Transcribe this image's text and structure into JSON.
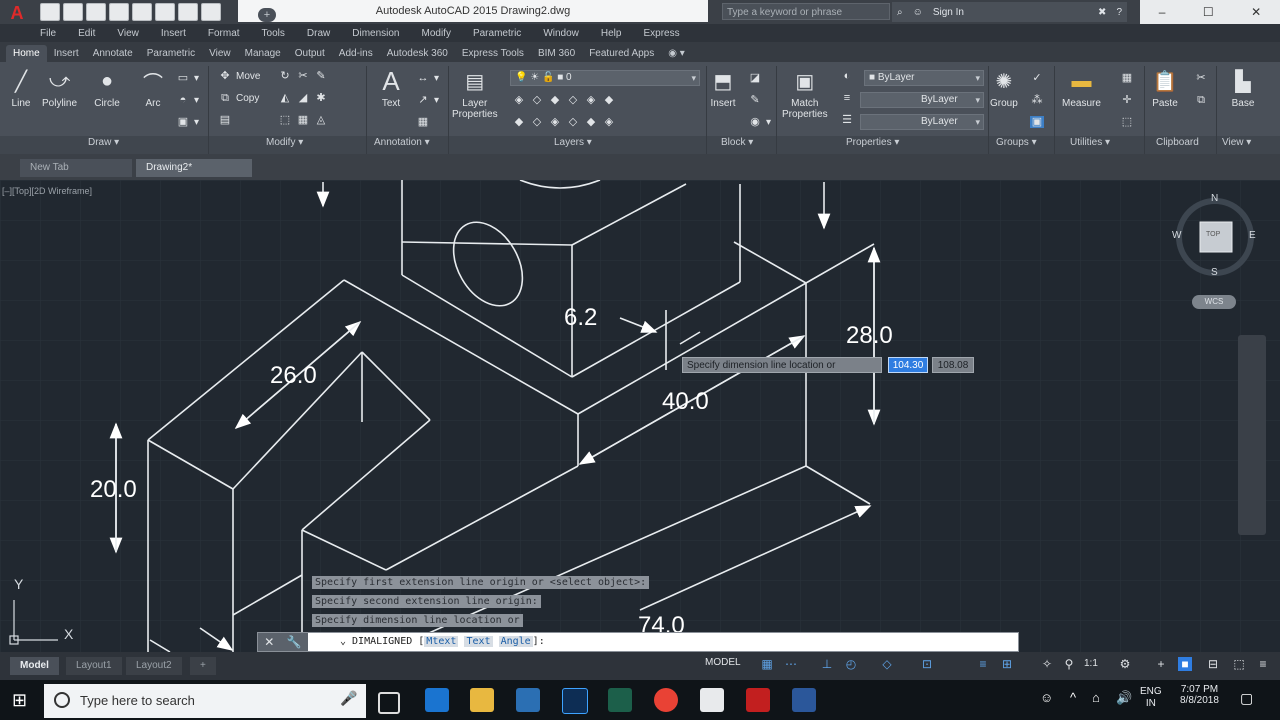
{
  "window": {
    "title": "Autodesk AutoCAD 2015    Drawing2.dwg",
    "search_placeholder": "Type a keyword or phrase",
    "sign_in": "Sign In",
    "min": "–",
    "max": "☐",
    "close": "✕"
  },
  "menu": [
    "File",
    "Edit",
    "View",
    "Insert",
    "Format",
    "Tools",
    "Draw",
    "Dimension",
    "Modify",
    "Parametric",
    "Window",
    "Help",
    "Express"
  ],
  "ribbon_tabs": [
    "Home",
    "Insert",
    "Annotate",
    "Parametric",
    "View",
    "Manage",
    "Output",
    "Add-ins",
    "Autodesk 360",
    "Express Tools",
    "BIM 360",
    "Featured Apps"
  ],
  "ribbon": {
    "draw": {
      "line": "Line",
      "polyline": "Polyline",
      "circle": "Circle",
      "arc": "Arc",
      "panel": "Draw ▾"
    },
    "modify": {
      "move": "Move",
      "copy": "Copy",
      "panel": "Modify ▾"
    },
    "annotation": {
      "text": "Text",
      "panel": "Annotation ▾"
    },
    "layers": {
      "layer_props_1": "Layer",
      "layer_props_2": "Properties",
      "current_layer": "0",
      "panel": "Layers ▾"
    },
    "block": {
      "insert": "Insert",
      "panel": "Block ▾"
    },
    "properties": {
      "match_1": "Match",
      "match_2": "Properties",
      "bylayer1": "ByLayer",
      "bylayer2": "ByLayer",
      "bylayer3": "ByLayer",
      "panel": "Properties ▾"
    },
    "groups": {
      "group": "Group",
      "panel": "Groups ▾"
    },
    "utilities": {
      "measure": "Measure",
      "panel": "Utilities ▾"
    },
    "clipboard": {
      "paste": "Paste",
      "panel": "Clipboard"
    },
    "view": {
      "base": "Base",
      "panel": "View ▾"
    }
  },
  "doc_tabs": {
    "new_tab": "New Tab",
    "drawing": "Drawing2*",
    "plus": "+"
  },
  "viewport_controls": "[–][Top][2D Wireframe]",
  "viewcube": {
    "n": "N",
    "s": "S",
    "e": "E",
    "w": "W",
    "face": "TOP",
    "wcs": "WCS"
  },
  "dimensions": {
    "d1": "6.2",
    "d2": "28.0",
    "d3": "26.0",
    "d4": "40.0",
    "d5": "20.0",
    "d6": "74.0"
  },
  "dynamic_input": {
    "prompt": "Specify dimension line location or",
    "value1": "104.30",
    "value2": "108.08"
  },
  "ucs": {
    "x": "X",
    "y": "Y"
  },
  "command_history": [
    "Specify first extension line origin or <select object>:",
    "Specify second extension line origin:",
    "Specify dimension line location or"
  ],
  "command_line": {
    "prefix": "⌄ DIMALIGNED [",
    "opt1": "Mtext",
    "opt2": "Text",
    "opt3": "Angle",
    "suffix": "]:"
  },
  "layout_tabs": [
    "Model",
    "Layout1",
    "Layout2"
  ],
  "status": {
    "model": "MODEL",
    "scale": "1:1"
  },
  "taskbar": {
    "search": "Type here to search",
    "lang1": "ENG",
    "lang2": "IN",
    "time": "7:07 PM",
    "date": "8/8/2018"
  }
}
